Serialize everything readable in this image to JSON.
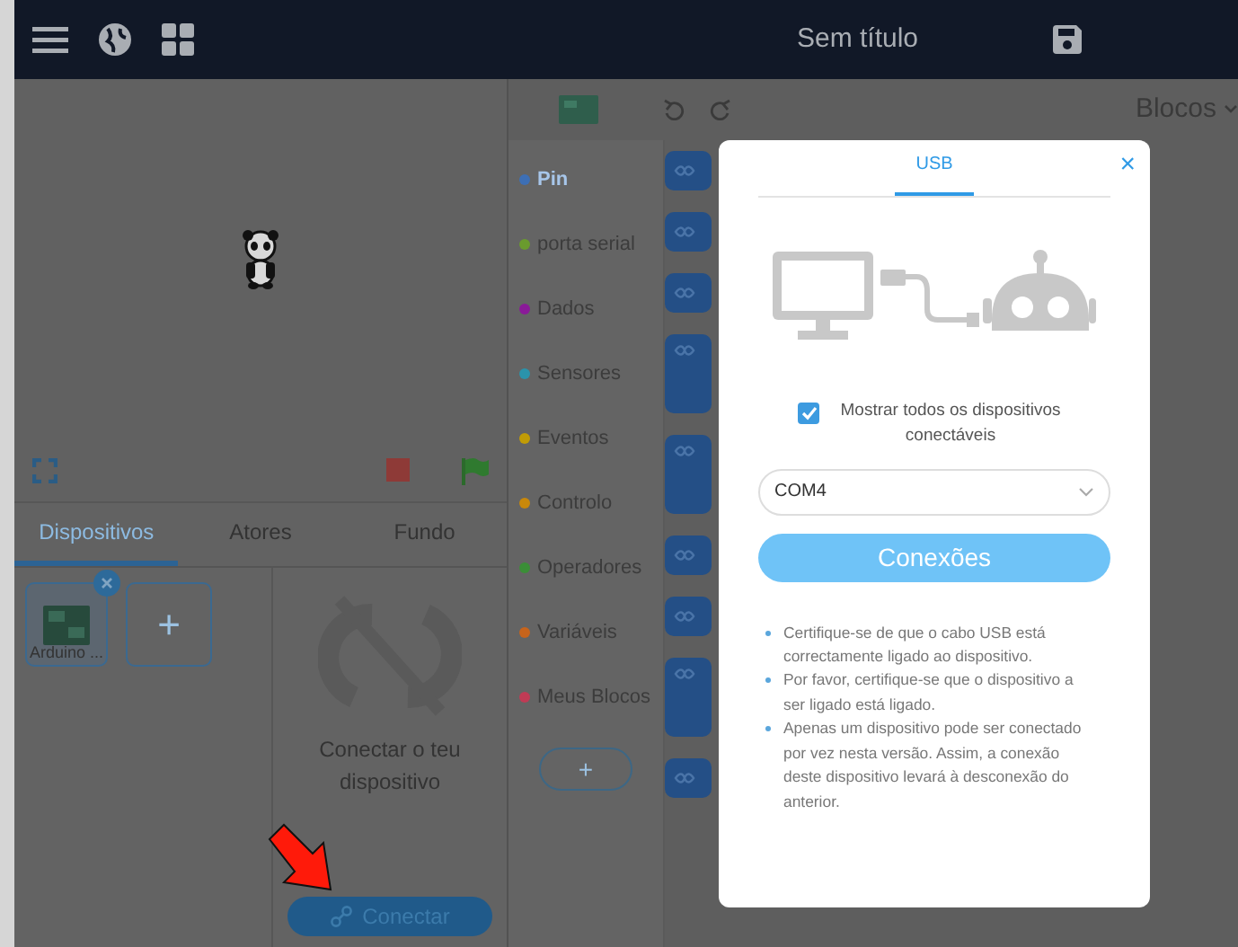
{
  "topbar": {
    "title": "Sem título"
  },
  "toolbar": {
    "mode": "Blocos"
  },
  "left_tabs": [
    {
      "label": "Dispositivos",
      "selected": true
    },
    {
      "label": "Atores",
      "selected": false
    },
    {
      "label": "Fundo",
      "selected": false
    }
  ],
  "devices": [
    {
      "label": "Arduino ..."
    }
  ],
  "add_device": "+",
  "connect_panel": {
    "message": "Conectar o teu dispositivo",
    "button": "Conectar"
  },
  "categories": [
    {
      "label": "Pin",
      "color": "#3d6fb5",
      "selected": true
    },
    {
      "label": "porta serial",
      "color": "#6a9b2e",
      "selected": false
    },
    {
      "label": "Dados",
      "color": "#8a1a98",
      "selected": false
    },
    {
      "label": "Sensores",
      "color": "#2a93ab",
      "selected": false
    },
    {
      "label": "Eventos",
      "color": "#c19c06",
      "selected": false
    },
    {
      "label": "Controlo",
      "color": "#c8880b",
      "selected": false
    },
    {
      "label": "Operadores",
      "color": "#3b8e37",
      "selected": false
    },
    {
      "label": "Variáveis",
      "color": "#c7641c",
      "selected": false
    },
    {
      "label": "Meus Blocos",
      "color": "#c03b55",
      "selected": false
    }
  ],
  "add_extension": "+",
  "dialog": {
    "tabs": [
      {
        "label": "USB",
        "selected": true
      }
    ],
    "close": "×",
    "show_all": {
      "label": "Mostrar todos os dispositivos conectáveis",
      "checked": true
    },
    "port": {
      "value": "COM4"
    },
    "connect_button": "Conexões",
    "tips": [
      "Certifique-se de que o cabo USB está correctamente ligado ao dispositivo.",
      "Por favor, certifique-se que o dispositivo a ser ligado está ligado.",
      "Apenas um dispositivo pode ser conectado por vez nesta versão. Assim, a conexão deste dispositivo levará à desconexão do anterior."
    ]
  }
}
